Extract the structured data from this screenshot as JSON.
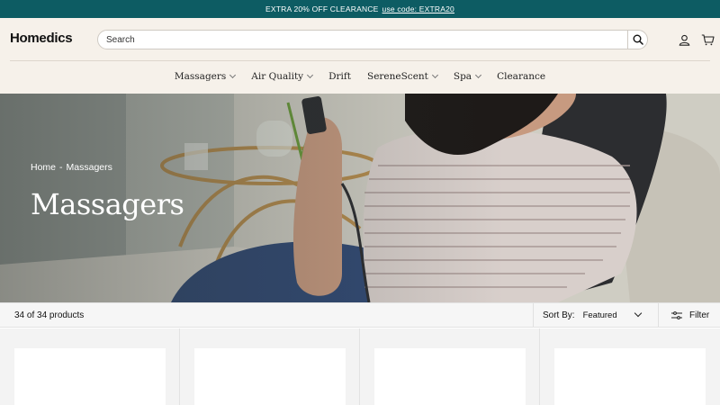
{
  "promo": {
    "text": "EXTRA 20% OFF CLEARANCE",
    "code": "use code: EXTRA20"
  },
  "header": {
    "logo": "Homedics",
    "search_placeholder": "Search",
    "icons": [
      "search-icon",
      "account-icon",
      "cart-icon"
    ]
  },
  "nav": {
    "items": [
      {
        "label": "Massagers",
        "has_dropdown": true
      },
      {
        "label": "Air Quality",
        "has_dropdown": true
      },
      {
        "label": "Drift",
        "has_dropdown": false
      },
      {
        "label": "SereneScent",
        "has_dropdown": true
      },
      {
        "label": "Spa",
        "has_dropdown": true
      },
      {
        "label": "Clearance",
        "has_dropdown": false
      }
    ]
  },
  "hero": {
    "breadcrumb": {
      "home": "Home",
      "separator": "-",
      "current": "Massagers"
    },
    "title": "Massagers"
  },
  "toolbar": {
    "count": "34 of 34 products",
    "sort_label": "Sort By:",
    "sort_value": "Featured",
    "filter_label": "Filter"
  },
  "colors": {
    "promo_bg": "#0d5c63",
    "header_bg": "#f6f1ea",
    "toolbar_bg": "#f6f6f6"
  }
}
